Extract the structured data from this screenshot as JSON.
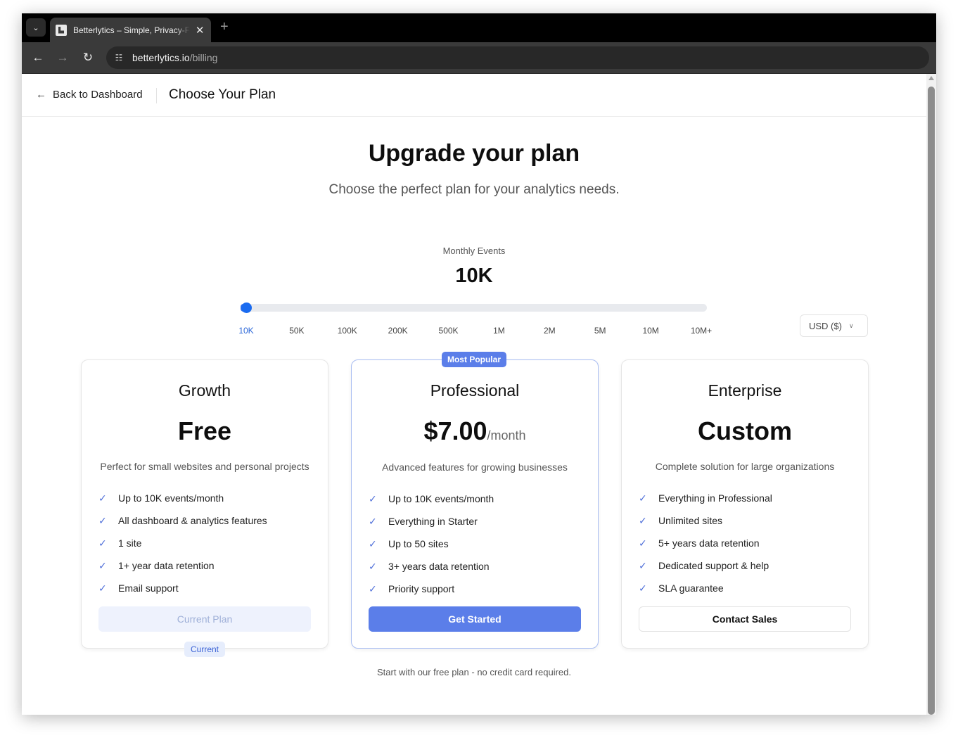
{
  "browser": {
    "tab_title": "Betterlytics – Simple, Privacy-Friendly Analytics",
    "url_host": "betterlytics.io",
    "url_path": "/billing"
  },
  "header": {
    "back_label": "Back to Dashboard",
    "title": "Choose Your Plan"
  },
  "hero": {
    "title": "Upgrade your plan",
    "subtitle": "Choose the perfect plan for your analytics needs."
  },
  "events": {
    "label": "Monthly Events",
    "value": "10K",
    "selected_index": 0,
    "ticks": [
      "10K",
      "50K",
      "100K",
      "200K",
      "500K",
      "1M",
      "2M",
      "5M",
      "10M",
      "10M+"
    ]
  },
  "currency": {
    "selected": "USD ($)"
  },
  "plans": [
    {
      "name": "Growth",
      "price": "Free",
      "unit": "",
      "description": "Perfect for small websites and personal projects",
      "features": [
        "Up to 10K events/month",
        "All dashboard & analytics features",
        "1 site",
        "1+ year data retention",
        "Email support"
      ],
      "button": "Current Plan",
      "badge": "Current"
    },
    {
      "name": "Professional",
      "price": "$7.00",
      "unit": "/month",
      "description": "Advanced features for growing businesses",
      "features": [
        "Up to 10K events/month",
        "Everything in Starter",
        "Up to 50 sites",
        "3+ years data retention",
        "Priority support"
      ],
      "button": "Get Started",
      "badge": "Most Popular"
    },
    {
      "name": "Enterprise",
      "price": "Custom",
      "unit": "",
      "description": "Complete solution for large organizations",
      "features": [
        "Everything in Professional",
        "Unlimited sites",
        "5+ years data retention",
        "Dedicated support & help",
        "SLA guarantee"
      ],
      "button": "Contact Sales"
    }
  ],
  "footnote": "Start with our free plan - no credit card required.",
  "colors": {
    "accent": "#5b7ee9",
    "slider_thumb": "#1a6bf0",
    "check": "#4f6fd9"
  },
  "icons": {
    "back": "arrow-left-icon",
    "check": "check-icon",
    "chevron": "chevron-down-icon"
  }
}
